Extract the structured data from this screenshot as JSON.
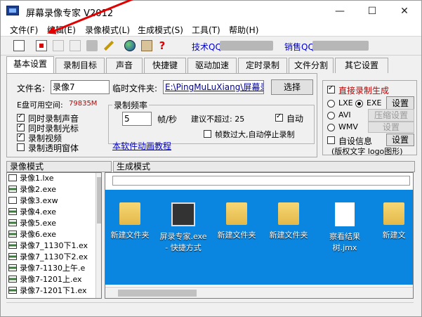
{
  "window": {
    "title": "屏幕录像专家 V2012"
  },
  "titlebar": {
    "minimize": "—",
    "maximize": "☐",
    "close": "✕"
  },
  "menu": [
    "文件(F)",
    "编辑(E)",
    "录像模式(L)",
    "生成模式(S)",
    "工具(T)",
    "帮助(H)"
  ],
  "toolbar": {
    "tech_qq_label": "技术QQ:",
    "sales_qq_label": "销售QQ:",
    "help_glyph": "?"
  },
  "tabs": [
    "基本设置",
    "录制目标",
    "声音",
    "快捷键",
    "驱动加速",
    "定时录制",
    "文件分割",
    "其它设置"
  ],
  "basic": {
    "filename_label": "文件名:",
    "filename_value": "录像7",
    "tempdir_label": "临时文件夹:",
    "tempdir_value": "E:\\PingMuLuXiang\\屏幕录",
    "browse_button": "选择",
    "disk_label": "E盘可用空间:",
    "disk_value": "79835M",
    "checks": [
      {
        "label": "同时录制声音",
        "checked": true
      },
      {
        "label": "同时录制光标",
        "checked": true
      },
      {
        "label": "录制视频",
        "checked": true
      },
      {
        "label": "录制透明窗体",
        "checked": false
      }
    ],
    "freq_title": "录制频率",
    "freq_value": "5",
    "freq_unit": "帧/秒",
    "limit_text": "建议不超过: 25",
    "auto_label": "自动",
    "auto_checked": true,
    "stop_label": "帧数过大,自动停止录制",
    "stop_checked": false,
    "tutorial_link": "本软件动画教程"
  },
  "gen": {
    "direct_label": "直接录制生成",
    "direct_checked": true,
    "formats": [
      {
        "label": "LXE",
        "selected": false
      },
      {
        "label": "EXE",
        "selected": true
      },
      {
        "label": "AVI",
        "selected": false
      },
      {
        "label": "WMV",
        "selected": false
      }
    ],
    "settings_label": "设置",
    "compress_label": "压缩设置",
    "info_label": "自设信息",
    "info_checked": false,
    "copyright_text": "(版权文字 logo图形)"
  },
  "sections": {
    "record_mode": "录像模式",
    "gen_mode": "生成模式"
  },
  "files": [
    {
      "name": "录像1.lxe",
      "type": "doc"
    },
    {
      "name": "录像2.exe",
      "type": "vid"
    },
    {
      "name": "录像3.exw",
      "type": "doc"
    },
    {
      "name": "录像4.exe",
      "type": "vid"
    },
    {
      "name": "录像5.exe",
      "type": "vid"
    },
    {
      "name": "录像6.exe",
      "type": "vid"
    },
    {
      "name": "录像7_1130下1.ex",
      "type": "vid"
    },
    {
      "name": "录像7_1130下2.ex",
      "type": "vid"
    },
    {
      "name": "录像7-1130上午.e",
      "type": "vid"
    },
    {
      "name": "录像7-1201上.ex",
      "type": "vid"
    },
    {
      "name": "录像7-1201下1.ex",
      "type": "vid"
    }
  ],
  "desktop_icons": [
    {
      "label": "新建文件夹",
      "kind": "folder"
    },
    {
      "label": "屏录专家.exe - 快捷方式",
      "kind": "exe"
    },
    {
      "label": "新建文件夹",
      "kind": "folder"
    },
    {
      "label": "新建文件夹",
      "kind": "folder"
    },
    {
      "label": "察看结果树.jmx",
      "kind": "doc"
    },
    {
      "label": "新建文",
      "kind": "folder"
    }
  ]
}
